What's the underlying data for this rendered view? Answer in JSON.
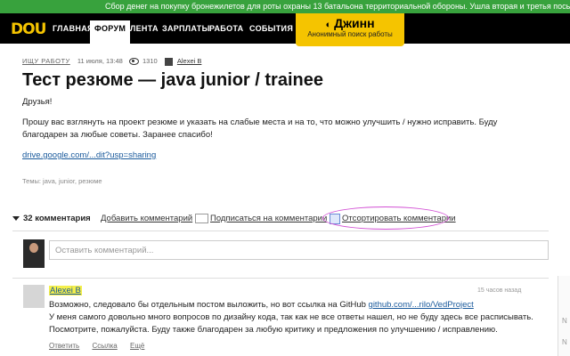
{
  "banner": "Сбор денег на покупку бронежилетов для роты охраны 13 батальона территориальной обороны. Ушла вторая и третья посылки. На 07.0",
  "logo": "DOU",
  "nav": [
    "ГЛАВНАЯ",
    "ФОРУМ",
    "ЛЕНТА",
    "ЗАРПЛАТЫ",
    "РАБОТА",
    "СОБЫТИЯ"
  ],
  "djinn": {
    "title": "Джинн",
    "subtitle": "Анонимный поиск работы"
  },
  "post": {
    "category": "Ищу работу",
    "date": "11 июля, 13:48",
    "views": "1310",
    "author": "Alexei B",
    "title": "Тест резюме — java junior / trainee",
    "greeting": "Друзья!",
    "body": "Прошу вас взглянуть на проект резюме и указать на слабые места и на то, что можно улучшить / нужно исправить. Буду благодарен за любые советы. Заранее спасибо!",
    "link": "drive.google.com/...dit?usp=sharing",
    "tags": "Темы: java, junior, резюме"
  },
  "comments_bar": {
    "count": "32 комментария",
    "add": "Добавить комментарий",
    "subscribe": "Подписаться на комментарии",
    "sort": "Отсортировать комментарии"
  },
  "input_placeholder": "Оставить комментарий...",
  "comment": {
    "author": "Alexei B",
    "time": "15 часов назад",
    "line1_prefix": "Возможно, следовало бы отдельным постом выложить, но вот ссылка на GitHub ",
    "line1_link": "github.com/...rilo/VedProject",
    "line2": "У меня самого довольно много вопросов по дизайну кода, так как не все ответы нашел, но не буду здесь все расписывать.",
    "line3": "Посмотрите, пожалуйста. Буду также благодарен за любую критику и предложения по улучшению / исправлению.",
    "actions": [
      "Ответить",
      "Ссылка",
      "Ещё"
    ]
  }
}
